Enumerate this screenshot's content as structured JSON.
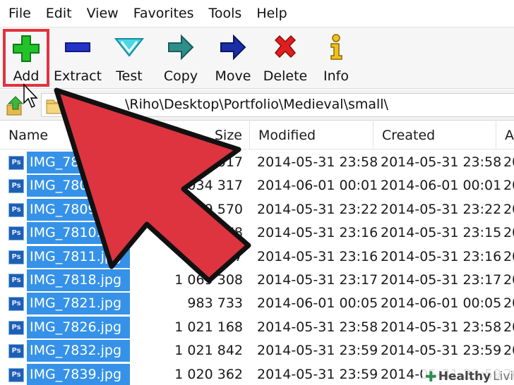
{
  "menubar": {
    "items": [
      "File",
      "Edit",
      "View",
      "Favorites",
      "Tools",
      "Help"
    ]
  },
  "toolbar": {
    "add_label": "Add",
    "extract_label": "Extract",
    "test_label": "Test",
    "copy_label": "Copy",
    "move_label": "Move",
    "delete_label": "Delete",
    "info_label": "Info"
  },
  "address": {
    "path": "\\Riho\\Desktop\\Portfolio\\Medieval\\small\\"
  },
  "columns": {
    "name": "Name",
    "size": "Size",
    "modified": "Modified",
    "created": "Created",
    "accessed": "A"
  },
  "files": [
    {
      "name": "IMG_7803.jpg",
      "size": "1 090 017",
      "modified": "2014-05-31 23:58",
      "created": "2014-05-31 23:58",
      "accessed": "20"
    },
    {
      "name": "IMG_7806.jpg",
      "size": "1 034 317",
      "modified": "2014-06-01 00:01",
      "created": "2014-06-01 00:01",
      "accessed": "20"
    },
    {
      "name": "IMG_7809.jpg",
      "size": "1 079 570",
      "modified": "2014-05-31 23:22",
      "created": "2014-05-31 23:22",
      "accessed": "20"
    },
    {
      "name": "IMG_7810.jpg",
      "size": "1 046 778",
      "modified": "2014-05-31 23:16",
      "created": "2014-05-31 23:15",
      "accessed": "20"
    },
    {
      "name": "IMG_7811.jpg",
      "size": "611 987",
      "modified": "2014-05-31 23:16",
      "created": "2014-05-31 23:16",
      "accessed": "20"
    },
    {
      "name": "IMG_7818.jpg",
      "size": "1 069 308",
      "modified": "2014-05-31 23:17",
      "created": "2014-05-31 23:17",
      "accessed": "20"
    },
    {
      "name": "IMG_7821.jpg",
      "size": "983 733",
      "modified": "2014-06-01 00:05",
      "created": "2014-06-01 00:05",
      "accessed": "20"
    },
    {
      "name": "IMG_7826.jpg",
      "size": "1 021 168",
      "modified": "2014-05-31 23:58",
      "created": "2014-05-31 23:58",
      "accessed": "20"
    },
    {
      "name": "IMG_7832.jpg",
      "size": "1 021 842",
      "modified": "2014-05-31 23:59",
      "created": "2014-05-31 23:59",
      "accessed": "20"
    },
    {
      "name": "IMG_7839.jpg",
      "size": "1 020 362",
      "modified": "2014-05-31 23:59",
      "created": "2014-05-31 23:59",
      "accessed": "20"
    }
  ],
  "file_icon_label": "Ps",
  "watermark": {
    "brand": "Healthy",
    "brand2": "Living"
  },
  "colors": {
    "selection": "#3592e8",
    "highlight_border": "#e0343e",
    "arrow_fill": "#dd3440"
  }
}
